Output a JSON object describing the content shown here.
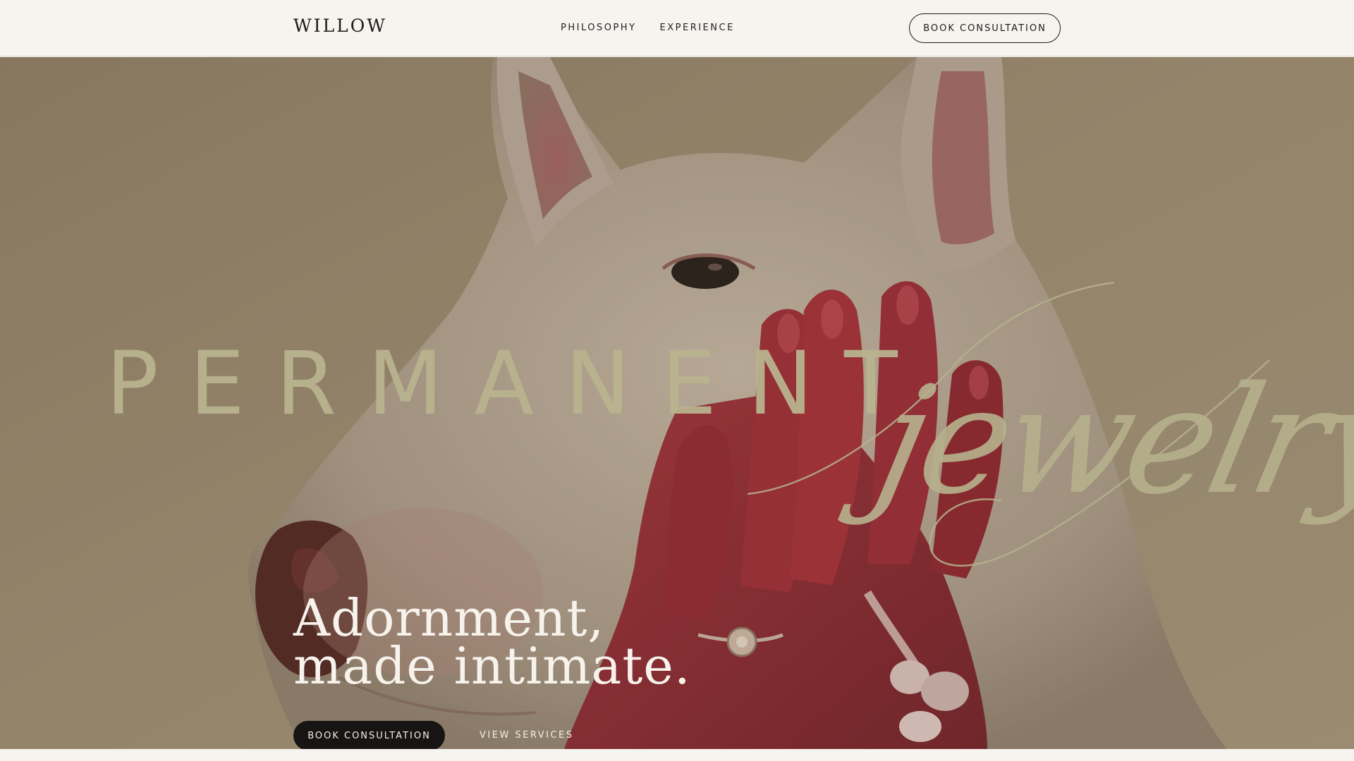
{
  "header": {
    "brand": "WILLOW",
    "nav": [
      {
        "label": "PHILOSOPHY"
      },
      {
        "label": "EXPERIENCE"
      }
    ],
    "cta_label": "BOOK CONSULTATION"
  },
  "hero": {
    "overlay_word_sans": "PERMANENT",
    "overlay_word_script": "jewelry",
    "headline_line1": "Adornment,",
    "headline_line2": "made intimate.",
    "primary_cta": "BOOK CONSULTATION",
    "secondary_cta": "VIEW SERVICES"
  },
  "colors": {
    "background": "#f6f4ef",
    "ink": "#1c1b1a",
    "overlay_text": "#b6b08c",
    "hero_button": "#161514",
    "hand_red": "#8e1f2a"
  }
}
